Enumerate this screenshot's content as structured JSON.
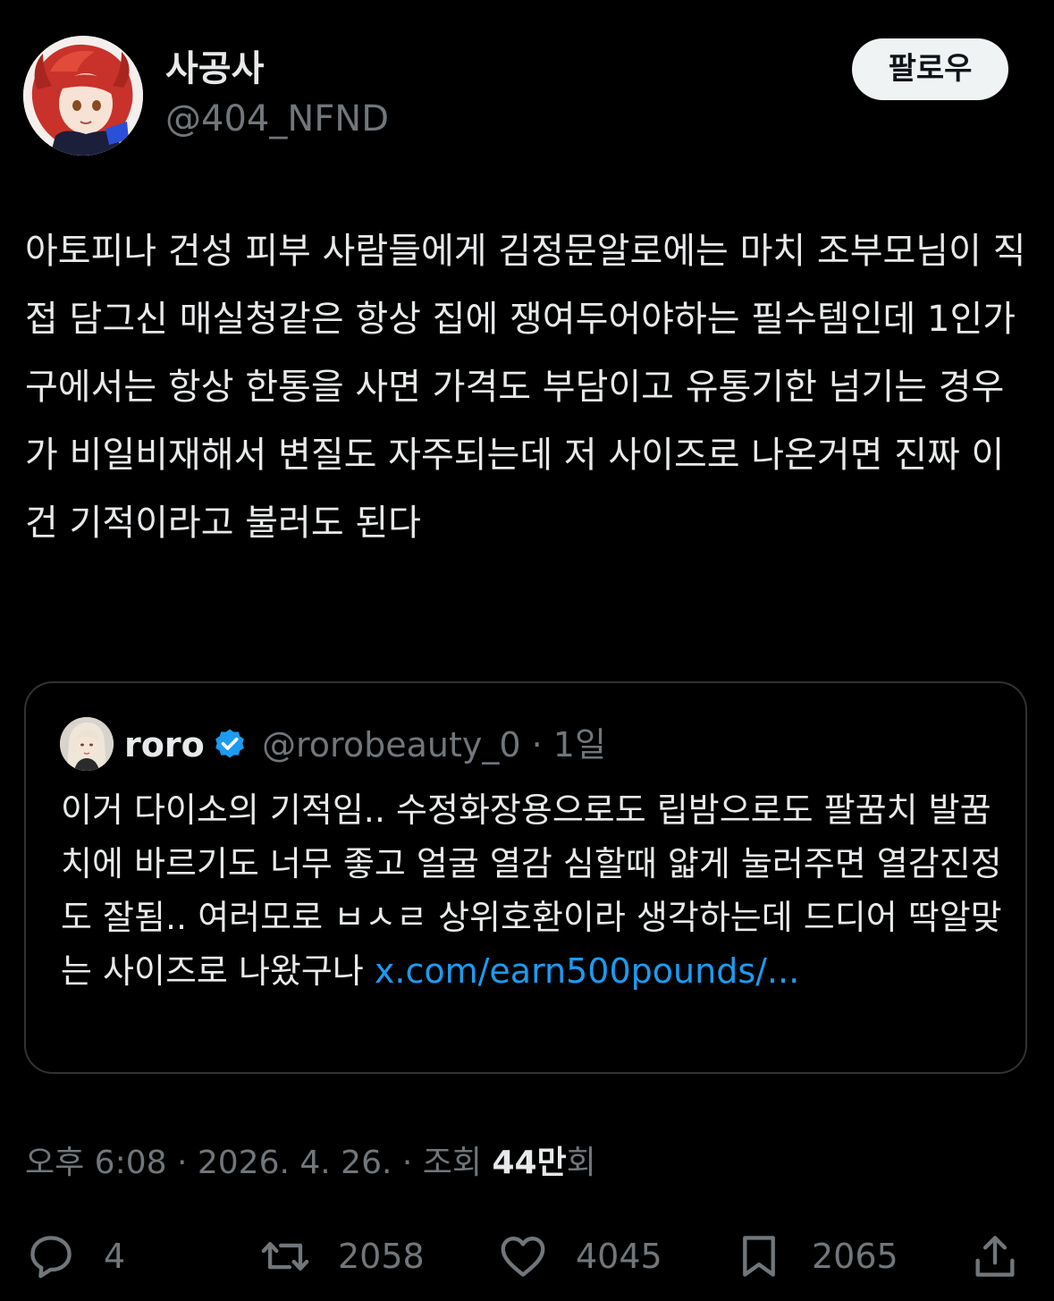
{
  "author": {
    "display_name": "사공사",
    "handle": "@404_NFND",
    "avatar_icon": "red-haired-anime-avatar"
  },
  "follow_button": {
    "label": "팔로우"
  },
  "tweet": {
    "text": "아토피나 건성 피부 사람들에게 김정문알로에는 마치 조부모님이 직접 담그신 매실청같은 항상 집에 쟁여두어야하는 필수템인데 1인가구에서는 항상 한통을 사면 가격도 부담이고 유통기한 넘기는 경우가 비일비재해서 변질도 자주되는데 저 사이즈로 나온거면 진짜 이건 기적이라고 불러도 된다"
  },
  "quote": {
    "display_name": "roro",
    "verified_icon": "verified-badge-icon",
    "handle": "@rorobeauty_0",
    "separator": "·",
    "age": "1일",
    "text": "이거 다이소의 기적임.. 수정화장용으로도 립밤으로도 팔꿈치 발꿈치에 바르기도 너무 좋고 얼굴 열감 심할때 얇게 눌러주면 열감진정도 잘됨..  여러모로 ㅂㅅㄹ 상위호환이라 생각하는데 드디어 딱알맞는 사이즈로 나왔구나 ",
    "link": "x.com/earn500pounds/..."
  },
  "meta": {
    "time": "오후 6:08",
    "sep1": " · ",
    "date": "2026. 4. 26.",
    "sep2": " · ",
    "views_label": "조회 ",
    "views_number": "44만",
    "views_unit": "회"
  },
  "actions": {
    "reply": {
      "icon": "reply-icon",
      "count": "4"
    },
    "retweet": {
      "icon": "retweet-icon",
      "count": "2058"
    },
    "like": {
      "icon": "heart-icon",
      "count": "4045"
    },
    "bookmark": {
      "icon": "bookmark-icon",
      "count": "2065"
    },
    "share": {
      "icon": "share-icon"
    }
  },
  "colors": {
    "background": "#000000",
    "text_primary": "#e7e9ea",
    "text_secondary": "#71767b",
    "link": "#1d9bf0",
    "border": "#2f3336",
    "verified": "#1d9bf0",
    "follow_bg": "#eff3f4"
  }
}
